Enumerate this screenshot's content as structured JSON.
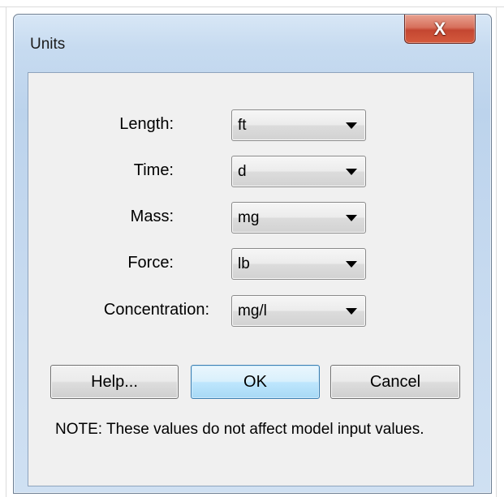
{
  "window": {
    "title": "Units",
    "close_glyph": "X"
  },
  "fields": [
    {
      "label": "Length:",
      "value": "ft"
    },
    {
      "label": "Time:",
      "value": "d"
    },
    {
      "label": "Mass:",
      "value": "mg"
    },
    {
      "label": "Force:",
      "value": "lb"
    },
    {
      "label": "Concentration:",
      "value": "mg/l"
    }
  ],
  "buttons": {
    "help": "Help...",
    "ok": "OK",
    "cancel": "Cancel"
  },
  "note": "NOTE: These values do not affect model input values.",
  "icons": {
    "close": "close-icon",
    "dropdown": "chevron-down-icon"
  }
}
